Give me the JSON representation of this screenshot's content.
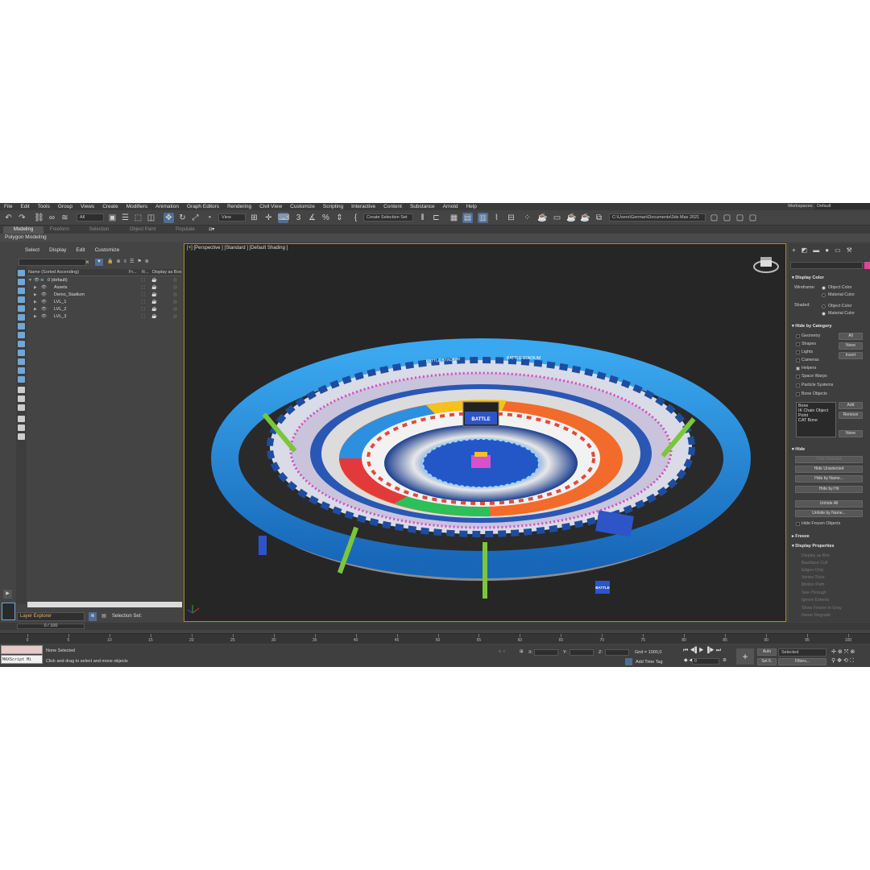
{
  "menu": [
    "File",
    "Edit",
    "Tools",
    "Group",
    "Views",
    "Create",
    "Modifiers",
    "Animation",
    "Graph Editors",
    "Rendering",
    "Civil View",
    "Customize",
    "Scripting",
    "Interactive",
    "Content",
    "Substance",
    "Arnold",
    "Help"
  ],
  "toolbar": {
    "filter_value": "All",
    "view_value": "View",
    "selection_set_placeholder": "Create Selection Set",
    "path_value": "C:\\Users\\German\\Documents\\3ds Max 2021",
    "workspaces_label": "Workspaces:",
    "workspaces_value": "Default"
  },
  "ribbon": {
    "tabs": [
      "Modeling",
      "Freeform",
      "Selection",
      "Object Paint",
      "Populate"
    ],
    "active_tab": "Modeling",
    "panel": "Polygon Modeling"
  },
  "scene_explorer": {
    "tabs": [
      "Select",
      "Display",
      "Edit",
      "Customize"
    ],
    "columns": {
      "name": "Name (Sorted Ascending)",
      "frozen": "Fr...",
      "render": "R...",
      "display_as_box": "Display as Box"
    },
    "layers": [
      {
        "name": "0 (default)"
      },
      {
        "name": "Assets"
      },
      {
        "name": "Demo_Stadium"
      },
      {
        "name": "LVL_1"
      },
      {
        "name": "LVL_2"
      },
      {
        "name": "LVL_3"
      }
    ],
    "layer_explorer_label": "Layer Explorer",
    "selection_set_label": "Selection Set:"
  },
  "viewport": {
    "label": "[+] [Perspective ] [Standard ] [Default Shading ]",
    "stadium_banner": "BATTLE STADIUM",
    "center_box_text": "BATTLE",
    "side_banner": "BATTLE"
  },
  "command_panel": {
    "display_color": {
      "title": "Display Color",
      "wireframe_label": "Wireframe:",
      "shaded_label": "Shaded:",
      "object_color": "Object Color",
      "material_color": "Material Color"
    },
    "hide_by_category": {
      "title": "Hide by Category",
      "items": [
        "Geometry",
        "Shapes",
        "Lights",
        "Cameras",
        "Helpers",
        "Space Warps",
        "Particle Systems",
        "Bone Objects"
      ],
      "buttons": [
        "All",
        "None",
        "Invert"
      ],
      "list": [
        "Bone",
        "IK Chain Object",
        "Point",
        "CAT Bone"
      ],
      "list_buttons": [
        "Add",
        "Remove",
        "None"
      ]
    },
    "hide": {
      "title": "Hide",
      "buttons": [
        "Hide Selected",
        "Hide Unselected",
        "Hide by Name...",
        "Hide by Hit",
        "Unhide All",
        "Unhide by Name..."
      ],
      "checkbox": "Hide Frozen Objects"
    },
    "freeze_title": "Freeze",
    "display_properties": {
      "title": "Display Properties",
      "items": [
        "Display as Box",
        "Backface Cull",
        "Edges Only",
        "Vertex Ticks",
        "Motion Path",
        "See-Through",
        "Ignore Extents",
        "Show Frozen in Gray",
        "Never Degrade"
      ]
    }
  },
  "timeline": {
    "slider": "0 / 100",
    "ticks": [
      "0",
      "5",
      "10",
      "15",
      "20",
      "25",
      "30",
      "35",
      "40",
      "45",
      "50",
      "55",
      "60",
      "65",
      "70",
      "75",
      "80",
      "85",
      "90",
      "95",
      "100"
    ]
  },
  "status": {
    "maxscript": "MAXScript Mi",
    "none_selected": "None Selected",
    "prompt": "Click and drag to select and move objects",
    "x_label": "X:",
    "y_label": "Y:",
    "z_label": "Z:",
    "grid": "Grid = 1000,0",
    "add_time_tag": "Add Time Tag",
    "auto": "Auto",
    "set_k": "Set K.",
    "selected": "Selected",
    "filters": "Filters...",
    "frame": "0"
  },
  "colors": {
    "ui_bg": "#444444",
    "viewport_bg": "#262626",
    "active_border": "#a38b2a",
    "accent_blue": "#4d6f95",
    "stadium_blue": "#1e8fd8",
    "stadium_green": "#7bc63a"
  }
}
